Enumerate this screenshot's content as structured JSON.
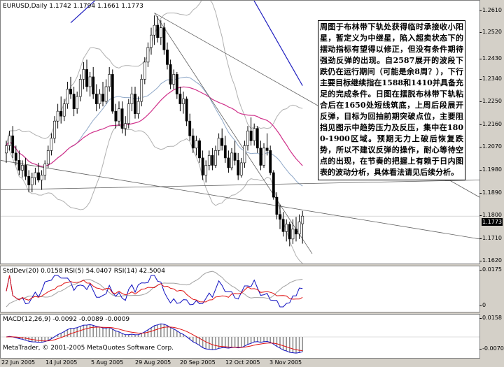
{
  "chart_data": [
    {
      "type": "candlestick",
      "header": "EURUSD,Daily  1.1742 1.1794 1.1661 1.1773",
      "yticks": [
        "1.2610",
        "1.2520",
        "1.2430",
        "1.2340",
        "1.2250",
        "1.2160",
        "1.2070",
        "1.1980",
        "1.1890",
        "1.1800",
        "1.1710",
        "1.1620"
      ],
      "ylim": [
        1.158,
        1.265
      ],
      "current_price": "1.1773",
      "overlays": [
        "Bollinger Bands",
        "moving averages",
        "trendlines"
      ],
      "annotation": "周图于布林带下轨处获得临时承接收小阳星，暂定义为中继星，陷入超卖状态下的摆动指标有望得以修正，但没有条件期待强劲反弹的出现。自2587展开的波段下跌仍在运行期间（可能是余8周？），下行主要目标继续指在1588和1410并具备充足的完成条件。日图在摆脱布林带下轨粘合后在1650处短线筑底，上周后段展开反弹，目标为回抽前期突破点位，主要阻挡见图示中趋势压力及反压，集中在1800-1900区域。预期无力上破后恢复跌势，所以不建议反弹的操作，耐心等待空点的出现，在节奏的把握上有赖于日内图表的波动分析，具体看法请见后续分析。"
    },
    {
      "type": "line",
      "header": "StdDev(20) 0.0158  RSI(5) 54.0407  RSI(14) 42.5004",
      "yticks": [
        "0.0175",
        "0"
      ],
      "series": [
        {
          "name": "StdDev(20)"
        },
        {
          "name": "RSI(5)"
        },
        {
          "name": "RSI(14)"
        }
      ]
    },
    {
      "type": "bar",
      "header": "MACD(12,26,9) -0.0092 -0.0089 -0.0009",
      "yticks": [
        "0.0158",
        "-0.0070"
      ],
      "footer": "MetaTrader, © 2001-2005 MetaQuotes Software Corp."
    }
  ],
  "x_axis": [
    "22 Jun 2005",
    "14 Jul 2005",
    "5 Aug 2005",
    "29 Aug 2005",
    "20 Sep 2005",
    "12 Oct 2005",
    "3 Nov 2005"
  ],
  "candles": [
    [
      1.203,
      1.208,
      1.199,
      1.206
    ],
    [
      1.206,
      1.212,
      1.204,
      1.21
    ],
    [
      1.21,
      1.214,
      1.201,
      1.203
    ],
    [
      1.203,
      1.206,
      1.198,
      1.2
    ],
    [
      1.2,
      1.204,
      1.194,
      1.196
    ],
    [
      1.196,
      1.2,
      1.193,
      1.198
    ],
    [
      1.198,
      1.201,
      1.192,
      1.1935
    ],
    [
      1.1935,
      1.196,
      1.187,
      1.19
    ],
    [
      1.19,
      1.195,
      1.187,
      1.193
    ],
    [
      1.193,
      1.197,
      1.19,
      1.195
    ],
    [
      1.195,
      1.199,
      1.191,
      1.192
    ],
    [
      1.192,
      1.196,
      1.188,
      1.194
    ],
    [
      1.194,
      1.2,
      1.192,
      1.1985
    ],
    [
      1.1985,
      1.206,
      1.197,
      1.204
    ],
    [
      1.204,
      1.211,
      1.202,
      1.209
    ],
    [
      1.209,
      1.218,
      1.207,
      1.216
    ],
    [
      1.216,
      1.223,
      1.213,
      1.22
    ],
    [
      1.22,
      1.226,
      1.215,
      1.218
    ],
    [
      1.218,
      1.225,
      1.216,
      1.223
    ],
    [
      1.223,
      1.232,
      1.221,
      1.229
    ],
    [
      1.229,
      1.234,
      1.225,
      1.227
    ],
    [
      1.227,
      1.23,
      1.218,
      1.221
    ],
    [
      1.221,
      1.228,
      1.219,
      1.226
    ],
    [
      1.226,
      1.235,
      1.224,
      1.233
    ],
    [
      1.233,
      1.24,
      1.229,
      1.237
    ],
    [
      1.237,
      1.241,
      1.228,
      1.23
    ],
    [
      1.23,
      1.236,
      1.226,
      1.234
    ],
    [
      1.234,
      1.238,
      1.225,
      1.227
    ],
    [
      1.227,
      1.231,
      1.22,
      1.223
    ],
    [
      1.223,
      1.229,
      1.221,
      1.227
    ],
    [
      1.227,
      1.232,
      1.222,
      1.224
    ],
    [
      1.224,
      1.233,
      1.223,
      1.23
    ],
    [
      1.23,
      1.238,
      1.228,
      1.235
    ],
    [
      1.235,
      1.237,
      1.219,
      1.22
    ],
    [
      1.22,
      1.223,
      1.213,
      1.216
    ],
    [
      1.216,
      1.224,
      1.214,
      1.221
    ],
    [
      1.221,
      1.224,
      1.211,
      1.213
    ],
    [
      1.213,
      1.218,
      1.21,
      1.215
    ],
    [
      1.215,
      1.225,
      1.213,
      1.223
    ],
    [
      1.223,
      1.23,
      1.22,
      1.227
    ],
    [
      1.227,
      1.23,
      1.217,
      1.219
    ],
    [
      1.219,
      1.226,
      1.217,
      1.224
    ],
    [
      1.224,
      1.235,
      1.222,
      1.233
    ],
    [
      1.233,
      1.242,
      1.231,
      1.24
    ],
    [
      1.24,
      1.248,
      1.238,
      1.246
    ],
    [
      1.246,
      1.254,
      1.243,
      1.251
    ],
    [
      1.251,
      1.259,
      1.247,
      1.255
    ],
    [
      1.255,
      1.2587,
      1.248,
      1.25
    ],
    [
      1.25,
      1.257,
      1.247,
      1.254
    ],
    [
      1.254,
      1.256,
      1.243,
      1.245
    ],
    [
      1.245,
      1.248,
      1.237,
      1.239
    ],
    [
      1.239,
      1.241,
      1.229,
      1.231
    ],
    [
      1.231,
      1.237,
      1.229,
      1.235
    ],
    [
      1.235,
      1.236,
      1.225,
      1.227
    ],
    [
      1.227,
      1.23,
      1.22,
      1.223
    ],
    [
      1.223,
      1.228,
      1.219,
      1.225
    ],
    [
      1.225,
      1.226,
      1.214,
      1.216
    ],
    [
      1.216,
      1.219,
      1.208,
      1.21
    ],
    [
      1.21,
      1.213,
      1.203,
      1.205
    ],
    [
      1.205,
      1.21,
      1.202,
      1.208
    ],
    [
      1.208,
      1.209,
      1.199,
      1.201
    ],
    [
      1.201,
      1.204,
      1.192,
      1.194
    ],
    [
      1.194,
      1.2,
      1.191,
      1.198
    ],
    [
      1.198,
      1.204,
      1.196,
      1.202
    ],
    [
      1.202,
      1.205,
      1.196,
      1.198
    ],
    [
      1.198,
      1.206,
      1.197,
      1.204
    ],
    [
      1.204,
      1.211,
      1.202,
      1.209
    ],
    [
      1.209,
      1.213,
      1.204,
      1.206
    ],
    [
      1.206,
      1.21,
      1.199,
      1.201
    ],
    [
      1.201,
      1.204,
      1.195,
      1.197
    ],
    [
      1.197,
      1.205,
      1.196,
      1.203
    ],
    [
      1.203,
      1.208,
      1.198,
      1.2
    ],
    [
      1.2,
      1.203,
      1.192,
      1.194
    ],
    [
      1.194,
      1.201,
      1.193,
      1.199
    ],
    [
      1.199,
      1.208,
      1.197,
      1.206
    ],
    [
      1.206,
      1.214,
      1.204,
      1.212
    ],
    [
      1.212,
      1.2175,
      1.206,
      1.208
    ],
    [
      1.208,
      1.215,
      1.206,
      1.213
    ],
    [
      1.213,
      1.214,
      1.203,
      1.205
    ],
    [
      1.205,
      1.208,
      1.196,
      1.198
    ],
    [
      1.198,
      1.207,
      1.197,
      1.205
    ],
    [
      1.205,
      1.211,
      1.202,
      1.204
    ],
    [
      1.204,
      1.206,
      1.194,
      1.195
    ],
    [
      1.195,
      1.196,
      1.184,
      1.185
    ],
    [
      1.185,
      1.187,
      1.176,
      1.178
    ],
    [
      1.178,
      1.182,
      1.172,
      1.176
    ],
    [
      1.176,
      1.179,
      1.169,
      1.171
    ],
    [
      1.171,
      1.176,
      1.167,
      1.174
    ],
    [
      1.174,
      1.175,
      1.165,
      1.168
    ],
    [
      1.168,
      1.176,
      1.166,
      1.172
    ],
    [
      1.172,
      1.177,
      1.167,
      1.17
    ],
    [
      1.17,
      1.178,
      1.168,
      1.175
    ],
    [
      1.1742,
      1.1794,
      1.1661,
      1.1773
    ]
  ]
}
